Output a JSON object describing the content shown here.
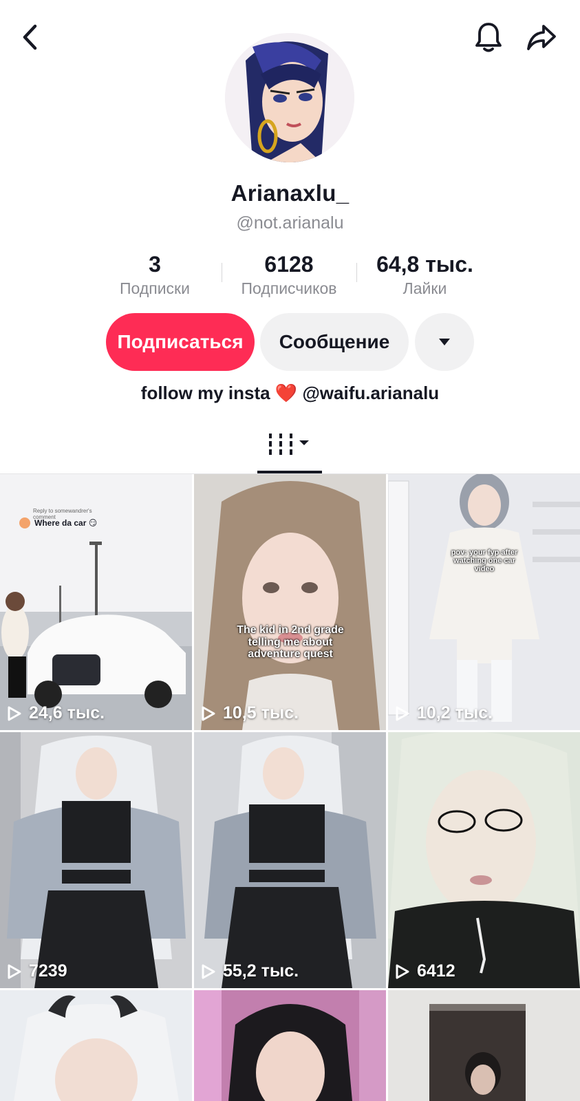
{
  "header": {
    "back_icon": "chevron-left-icon",
    "bell_icon": "bell-icon",
    "share_icon": "share-arrow-icon"
  },
  "profile": {
    "display_name": "Arianaxlu_",
    "handle": "@not.arianalu",
    "bio_prefix": "follow my insta",
    "bio_emoji": "❤️",
    "bio_suffix": "@waifu.arianalu"
  },
  "stats": [
    {
      "value": "3",
      "label": "Подписки"
    },
    {
      "value": "6128",
      "label": "Подписчиков"
    },
    {
      "value": "64,8 тыс.",
      "label": "Лайки"
    }
  ],
  "actions": {
    "follow_label": "Подписаться",
    "message_label": "Сообщение",
    "more_icon": "caret-down-icon"
  },
  "tab": {
    "icon": "grid-icon"
  },
  "colors": {
    "accent": "#fe2c55",
    "text": "#161823",
    "muted": "#8a8b91",
    "button_gray": "#f1f1f2"
  },
  "videos": [
    {
      "views": "24,6 тыс.",
      "reply_line": "Reply to somewandrer's comment",
      "caption": "Where da car 😏"
    },
    {
      "views": "10,5 тыс.",
      "caption": "The kid in 2nd grade telling me about adventure quest"
    },
    {
      "views": "10,2 тыс.",
      "caption": "pov: your fyp after watching one car video"
    },
    {
      "views": "7239"
    },
    {
      "views": "55,2 тыс."
    },
    {
      "views": "6412"
    },
    {
      "views": ""
    },
    {
      "views": ""
    },
    {
      "views": ""
    }
  ]
}
